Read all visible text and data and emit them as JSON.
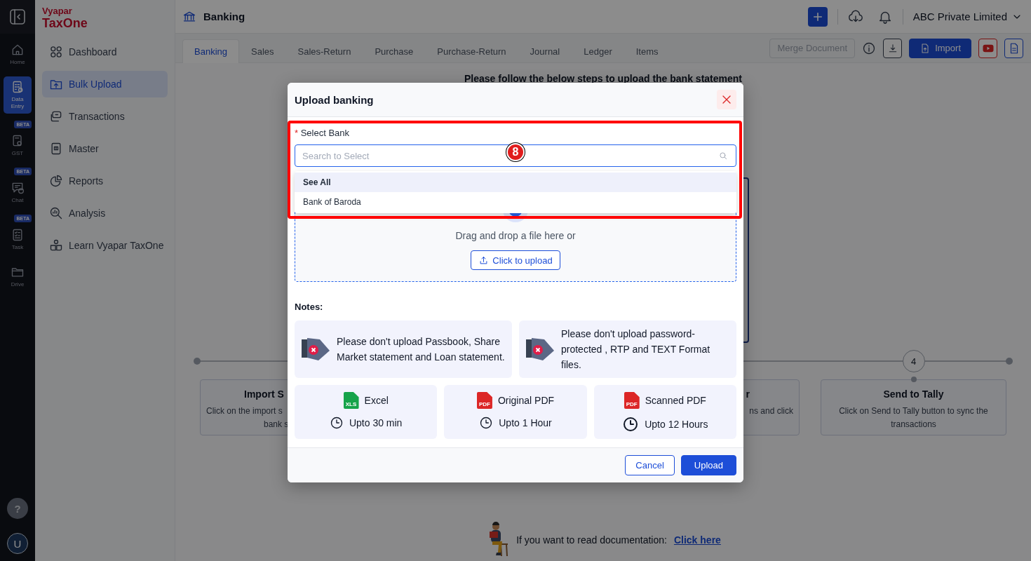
{
  "rail": {
    "items": [
      {
        "kind": "home",
        "label": "Home",
        "selected": false
      },
      {
        "kind": "data-entry",
        "label": "Data Entry",
        "selected": true
      },
      {
        "kind": "gst",
        "label": "GST",
        "badge": "BETA",
        "selected": false
      },
      {
        "kind": "chat",
        "label": "Chat",
        "badge": "BETA",
        "selected": false
      },
      {
        "kind": "task",
        "label": "Task",
        "badge": "BETA",
        "selected": false
      },
      {
        "kind": "drive",
        "label": "Drive",
        "selected": false
      }
    ],
    "help": "?",
    "avatar": "U"
  },
  "sidebar": {
    "brand": "Vyapar",
    "product": "TaxOne",
    "items": [
      {
        "kind": "dashboard",
        "label": "Dashboard",
        "selected": false
      },
      {
        "kind": "bulk-upload",
        "label": "Bulk Upload",
        "selected": true
      },
      {
        "kind": "transactions",
        "label": "Transactions",
        "selected": false
      },
      {
        "kind": "master",
        "label": "Master",
        "selected": false
      },
      {
        "kind": "reports",
        "label": "Reports",
        "selected": false
      },
      {
        "kind": "analysis",
        "label": "Analysis",
        "selected": false
      },
      {
        "kind": "learn",
        "label": "Learn Vyapar TaxOne",
        "selected": false
      }
    ]
  },
  "header": {
    "title": "Banking",
    "account": "ABC Private Limited"
  },
  "tabs": [
    {
      "label": "Banking",
      "selected": true
    },
    {
      "label": "Sales",
      "selected": false
    },
    {
      "label": "Sales-Return",
      "selected": false
    },
    {
      "label": "Purchase",
      "selected": false
    },
    {
      "label": "Purchase-Return",
      "selected": false
    },
    {
      "label": "Journal",
      "selected": false
    },
    {
      "label": "Ledger",
      "selected": false
    },
    {
      "label": "Items",
      "selected": false
    }
  ],
  "actions": {
    "merge": {
      "label": "Merge Document",
      "disabled": true
    },
    "import": "Import"
  },
  "page": {
    "heading": "Please follow the below steps to upload the bank statement",
    "steps": [
      {
        "title": "Import S",
        "lines": [
          "Click on the import s",
          "bank s"
        ]
      },
      {
        "title": "r",
        "lines": [
          "ns and click"
        ]
      },
      {
        "number": "4",
        "title": "Send to Tally",
        "lines": [
          "Click on Send to Tally button to sync the",
          "transactions"
        ]
      }
    ],
    "help_text": "If you want to read documentation:",
    "help_link": "Click here"
  },
  "dialog": {
    "title": "Upload banking",
    "field": {
      "label": "Select Bank",
      "required_mark": "*",
      "placeholder": "Search to Select"
    },
    "options": [
      {
        "kind": "all",
        "label": "See All",
        "selected": true
      },
      {
        "kind": "bank",
        "label": "Bank of Baroda",
        "selected": false
      }
    ],
    "annotation": {
      "marker": "8"
    },
    "dropzone": {
      "text": "Drag and drop a file here or",
      "button": "Click to upload"
    },
    "notes_label": "Notes:",
    "notes": [
      "Please don't upload Passbook, Share Market statement and Loan statement.",
      "Please don't upload password-protected , RTP and TEXT Format files."
    ],
    "formats": [
      {
        "kind": "excel",
        "badge": "XLS",
        "name": "Excel",
        "time": "Upto 30 min"
      },
      {
        "kind": "pdf",
        "badge": "PDF",
        "name": "Original PDF",
        "time": "Upto 1 Hour"
      },
      {
        "kind": "pdf",
        "badge": "PDF",
        "name": "Scanned PDF",
        "time": "Upto 12 Hours"
      }
    ],
    "buttons": [
      {
        "kind": "secondary",
        "label": "Cancel"
      },
      {
        "kind": "primary",
        "label": "Upload"
      }
    ]
  }
}
